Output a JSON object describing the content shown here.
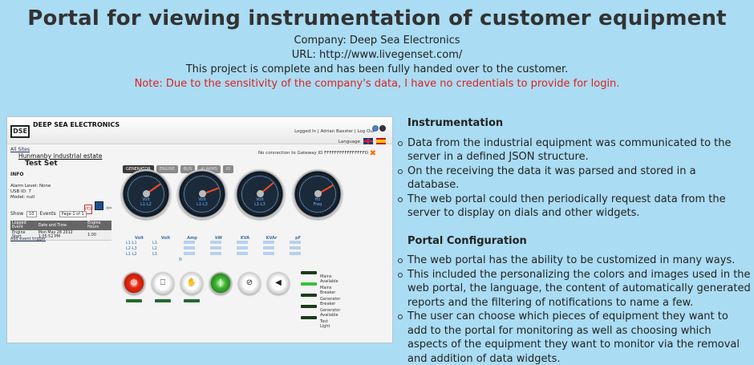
{
  "header": {
    "title": "Portal for viewing instrumentation of customer equipment",
    "company": "Company: Deep Sea Electronics",
    "url": "URL: http://www.livegenset.com/",
    "status": "This project is complete and has been fully handed over to the customer.",
    "note": "Note: Due to the sensitivity of the company's data, I have no credentials to provide for login."
  },
  "screenshot": {
    "logo": "DSE",
    "brand": "DEEP SEA ELECTRONICS",
    "login": "Logged In | Adrian Baxster | Log Out",
    "language_label": "Language",
    "all_sites": "All Sites",
    "site_name": "Hunmanby industrial estate",
    "test_set": "Test Set",
    "gateway_msg": "No connection to Gateway ID FFFFFFFFFFFFFFFFD",
    "tabs": [
      "GENERATOR",
      "ENGINE",
      "BUS",
      "ALARMS",
      "IO"
    ],
    "info": {
      "heading": "INFO",
      "alarm": "Alarm Level: None",
      "usb": "USB ID: 7",
      "model": "Model: null"
    },
    "show_label": "Show",
    "show_value": "10",
    "events_label": "Events",
    "page_value": "Page 1 of 1",
    "events_headers": [
      "Logged Event",
      "Date and Time",
      "Engine Hours"
    ],
    "events_rows": [
      [
        "Engine Start",
        "Mon May 28 2012 1:05:52 PM",
        "1:00"
      ]
    ],
    "add_event": "Add event trigger",
    "dials": [
      {
        "unit": "Volt",
        "label": "L1-L2",
        "angle": -35
      },
      {
        "unit": "Volt",
        "label": "L1-L3",
        "angle": -20
      },
      {
        "unit": "Volt",
        "label": "L1-L3",
        "angle": -40
      },
      {
        "unit": "Hz",
        "label": "Freq",
        "angle": -30
      }
    ],
    "meter_headers": [
      "Volt",
      "Volt",
      "Amp",
      "kW",
      "KVA",
      "KVAr",
      "pF"
    ],
    "meter_rows": [
      [
        "L1-L1",
        "L1",
        "",
        "",
        "",
        "",
        ""
      ],
      [
        "L2-L3",
        "L2",
        "",
        "",
        "",
        "",
        ""
      ],
      [
        "L1-L2",
        "L3",
        "",
        "",
        "",
        "",
        ""
      ]
    ],
    "meter_extra": "N",
    "buttons": [
      "stop",
      "auto",
      "manual",
      "start",
      "mute",
      "horn"
    ],
    "status_items": [
      {
        "label": "Mains Available",
        "on": false
      },
      {
        "label": "Mains Breaker",
        "on": true
      },
      {
        "label": "Generator Breaker",
        "on": false
      },
      {
        "label": "Generator Available",
        "on": false
      },
      {
        "label": "Test Light",
        "on": false
      }
    ],
    "colors": {
      "needle": "#ff4a20",
      "status_on": "#3ac03a",
      "status_off": "#1c3a1c"
    }
  },
  "right": {
    "sections": [
      {
        "heading": "Instrumentation",
        "items": [
          "Data from the industrial equipment was communicated to the server in a defined JSON structure.",
          "On the receiving the data it was parsed and stored in a database.",
          "The web portal could then periodically request data from the server to display on dials and other widgets."
        ]
      },
      {
        "heading": "Portal Configuration",
        "items": [
          "The web portal has the ability to be customized in many ways.",
          "This included the personalizing the colors and images used in the web portal, the language, the content of automatically generated reports and the filtering of notifications to name a few.",
          "The user can choose which pieces of equipment they want to add to the portal for monitoring as well as choosing which aspects of the equipment they want to monitor via the removal and addition of data widgets."
        ]
      }
    ]
  }
}
